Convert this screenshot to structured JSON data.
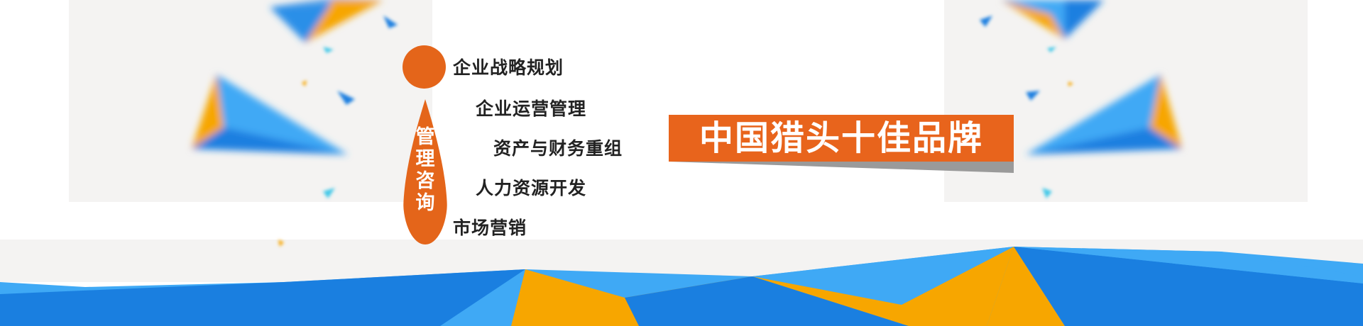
{
  "vertical_label": [
    "管",
    "理",
    "咨",
    "询"
  ],
  "menu": [
    {
      "label": "企业战略规划"
    },
    {
      "label": "企业运营管理"
    },
    {
      "label": "资产与财务重组"
    },
    {
      "label": "人力资源开发"
    },
    {
      "label": "市场营销"
    }
  ],
  "banner": {
    "text": "中国猎头十佳品牌"
  },
  "colors": {
    "accent_orange": "#e4651a",
    "sky_blue": "#3fa9f5",
    "deep_blue": "#1a7fe0",
    "yellow": "#f7a600",
    "panel_gray": "#f4f3f2"
  }
}
